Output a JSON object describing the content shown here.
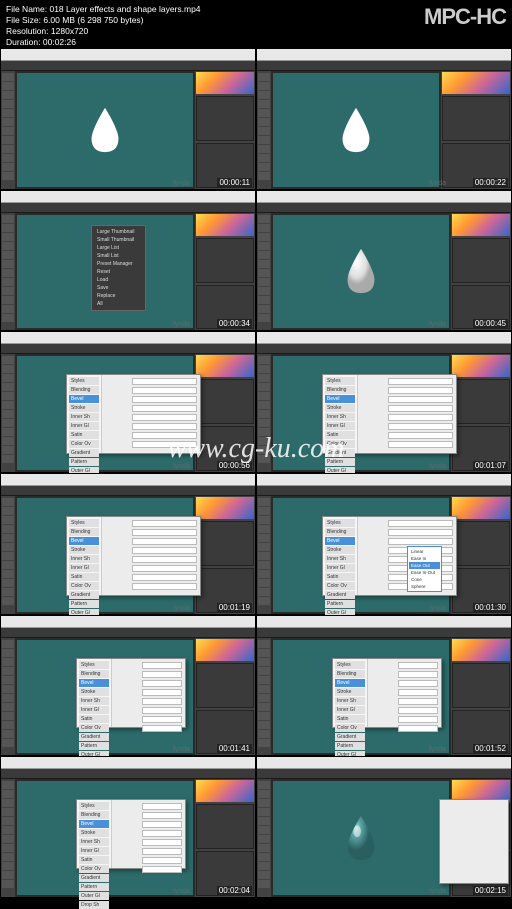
{
  "player": {
    "app": "MPC-HC",
    "filename_label": "File Name:",
    "filename": "018 Layer effects and shape layers.mp4",
    "filesize_label": "File Size:",
    "filesize": "6.00 MB (6 298 750 bytes)",
    "resolution_label": "Resolution:",
    "resolution": "1280x720",
    "duration_label": "Duration:",
    "duration": "00:02:26"
  },
  "watermark": "www.cg-ku.com",
  "lynda": "lynda",
  "frames": [
    {
      "ts": "00:00:11",
      "drop": "white-flat",
      "overlay": "none"
    },
    {
      "ts": "00:00:22",
      "drop": "white-flat",
      "overlay": "none",
      "wide_panel": true
    },
    {
      "ts": "00:00:34",
      "drop": "white-flat",
      "overlay": "context"
    },
    {
      "ts": "00:00:45",
      "drop": "white-bevel",
      "overlay": "none"
    },
    {
      "ts": "00:00:56",
      "drop": "white-bevel",
      "overlay": "dialog"
    },
    {
      "ts": "00:01:07",
      "drop": "teal-dark",
      "overlay": "dialog"
    },
    {
      "ts": "00:01:19",
      "drop": "teal-dark",
      "overlay": "dialog"
    },
    {
      "ts": "00:01:30",
      "drop": "teal-dark",
      "overlay": "dialog-dropdown"
    },
    {
      "ts": "00:01:41",
      "drop": "teal-glossy",
      "overlay": "dialog-small"
    },
    {
      "ts": "00:01:52",
      "drop": "teal-glossy",
      "overlay": "dialog-small"
    },
    {
      "ts": "00:02:04",
      "drop": "teal-glossy",
      "overlay": "dialog-small"
    },
    {
      "ts": "00:02:15",
      "drop": "teal-glossy",
      "overlay": "panel-overlay"
    }
  ],
  "dialog": {
    "sidebar": [
      "Styles",
      "Blending",
      "Bevel",
      "Stroke",
      "Inner Sh",
      "Inner Gl",
      "Satin",
      "Color Ov",
      "Gradient",
      "Pattern",
      "Outer Gl",
      "Drop Sh"
    ]
  },
  "context": {
    "items": [
      "Large Thumbnail",
      "Small Thumbnail",
      "Large List",
      "Small List",
      "Preset Manager",
      "Reset",
      "Load",
      "Save",
      "Replace",
      "All"
    ]
  },
  "dropdown": {
    "items": [
      "Linear",
      "Ease In",
      "Ease Out",
      "Ease In-Out",
      "Cone",
      "Sphere"
    ]
  }
}
